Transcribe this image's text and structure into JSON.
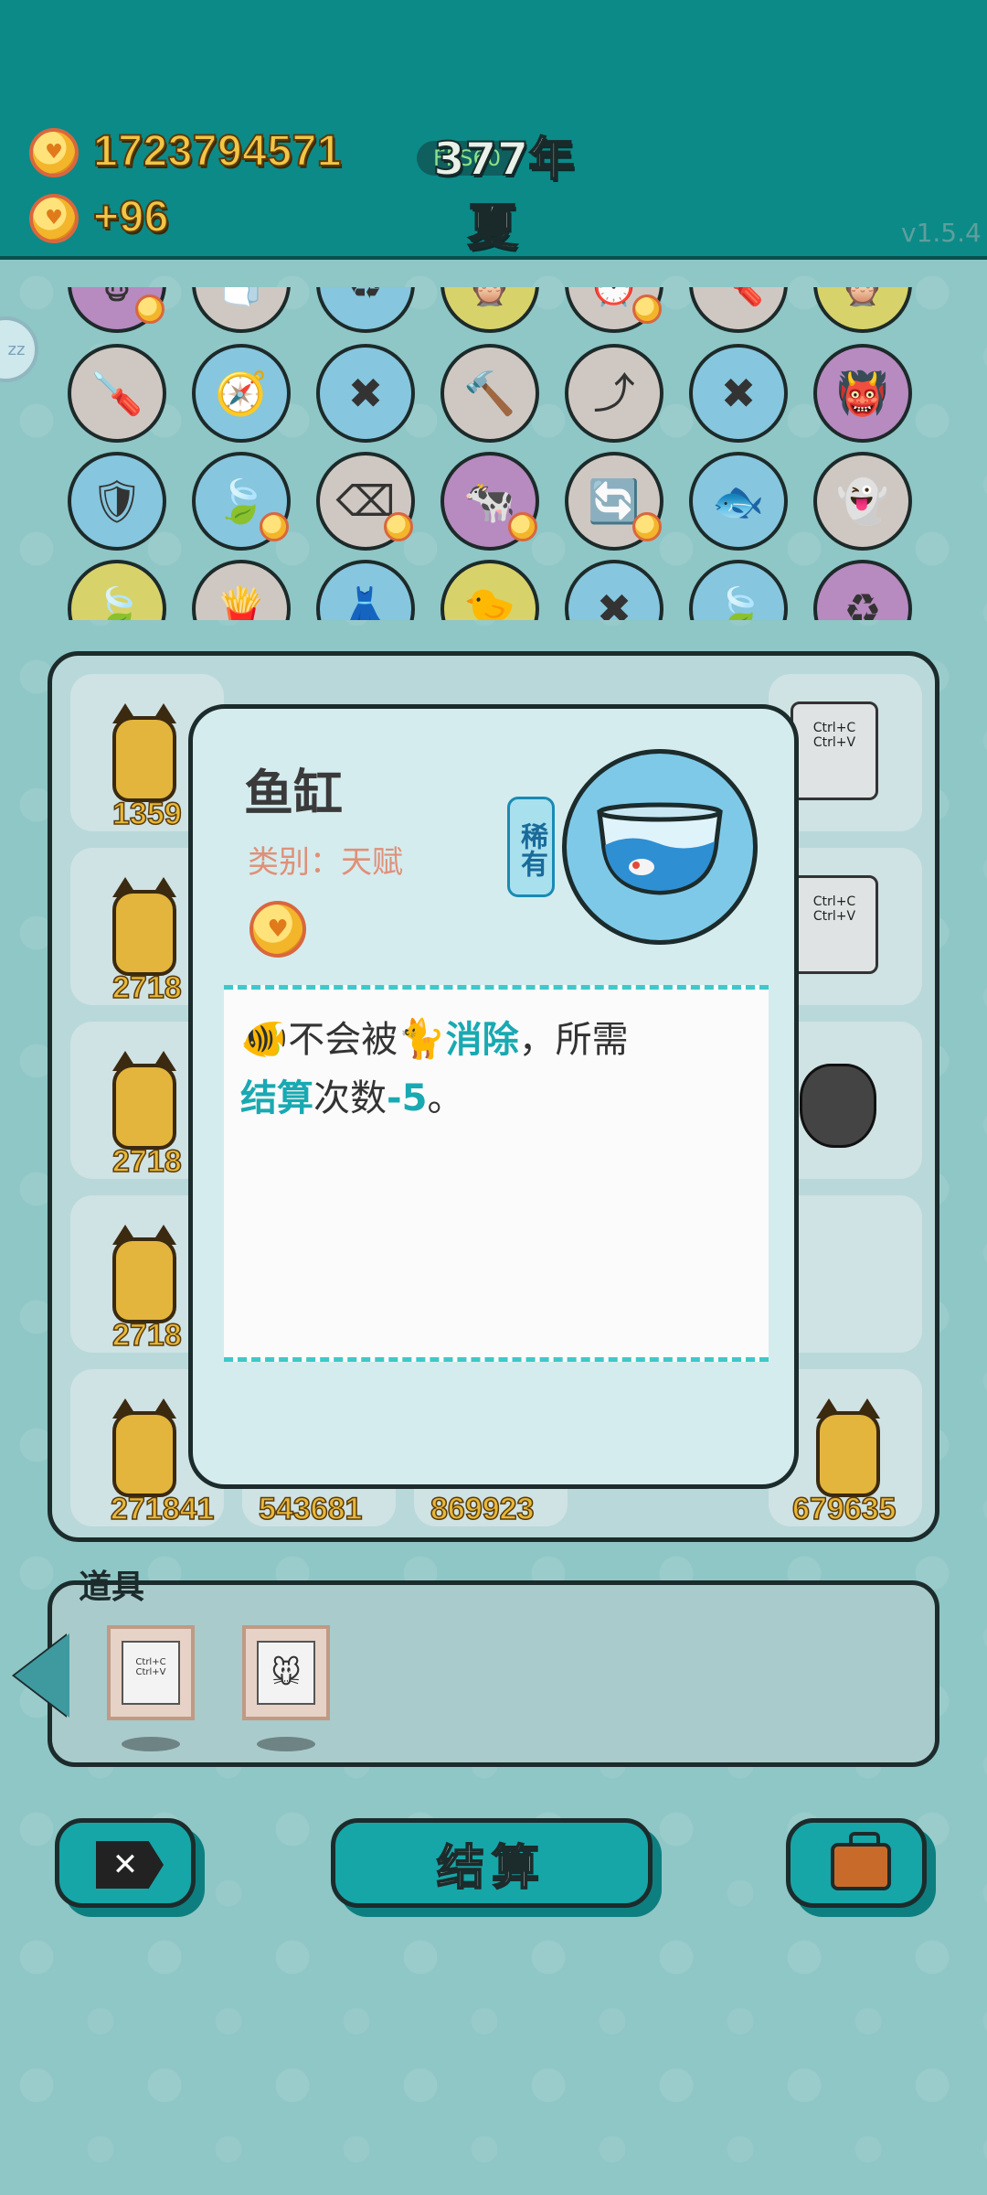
{
  "header": {
    "gold_total": "1723794571",
    "gold_income": "+96",
    "year": "377年",
    "season": "夏",
    "fps": "FPS60",
    "version": "v1.5.4",
    "side_badge": "zz"
  },
  "items_row_icons": [
    [
      "cow-icon",
      "tissue-icon",
      "trash-recycle-icon",
      "owl-icon",
      "clock-icon",
      "screwdriver-icon",
      "owl-icon"
    ],
    [
      "screwdriver-icon",
      "compass-icon",
      "bamboo-icon",
      "hammer-icon",
      "arrow-up-icon",
      "bamboo-icon",
      "demon-card-icon"
    ],
    [
      "shield-icon",
      "leaf-icon",
      "delete-tag-icon",
      "cows-icon",
      "recycle-icon",
      "fishbowl-icon",
      "ghost-icon"
    ],
    [
      "leaf-icon",
      "fries-icon",
      "skirt-icon",
      "chick-icon",
      "bamboo-icon",
      "leaf-icon",
      "recycle-bin-icon"
    ]
  ],
  "board": {
    "cells": [
      {
        "row": 0,
        "col": 0,
        "content": "cat",
        "value": "1359"
      },
      {
        "row": 0,
        "col": 4,
        "content": "ctrl-card",
        "value": "Ctrl+C Ctrl+V"
      },
      {
        "row": 1,
        "col": 0,
        "content": "cat",
        "value": "2718"
      },
      {
        "row": 1,
        "col": 4,
        "content": "ctrl-card",
        "value": "Ctrl+C Ctrl+V"
      },
      {
        "row": 2,
        "col": 0,
        "content": "cat",
        "value": "2718"
      },
      {
        "row": 2,
        "col": 4,
        "content": "trash-bag",
        "value": ""
      },
      {
        "row": 3,
        "col": 0,
        "content": "cat",
        "value": "2718"
      },
      {
        "row": 4,
        "col": 0,
        "content": "cat",
        "value": "271841"
      },
      {
        "row": 4,
        "col": 1,
        "content": "empty",
        "value": "543681"
      },
      {
        "row": 4,
        "col": 2,
        "content": "empty",
        "value": "869923"
      },
      {
        "row": 4,
        "col": 4,
        "content": "cat",
        "value": "679635"
      }
    ]
  },
  "modal": {
    "title": "鱼缸",
    "category": "类别：天赋",
    "rarity": "稀有",
    "desc_line1_a": "不会被",
    "desc_line1_hl": "消除",
    "desc_line1_b": "，所需",
    "desc_line2_hl": "结算",
    "desc_line2_b": "次数",
    "desc_line2_num": "-5",
    "desc_line2_end": "。",
    "icon": "fishbowl-icon"
  },
  "tools": {
    "title": "道具",
    "items": [
      {
        "icon": "ctrl-cv-card-icon",
        "label": "Ctrl+C Ctrl+V"
      },
      {
        "icon": "mouse-card-icon",
        "label": ""
      }
    ]
  },
  "buttons": {
    "settle": "结算",
    "clear_icon": "delete-tag-icon",
    "bag_icon": "briefcase-icon"
  },
  "colors": {
    "top_bar": "#0b8a88",
    "accent": "#16a6a8",
    "highlight_text": "#19a9b2",
    "gold_text": "#f3c545"
  }
}
